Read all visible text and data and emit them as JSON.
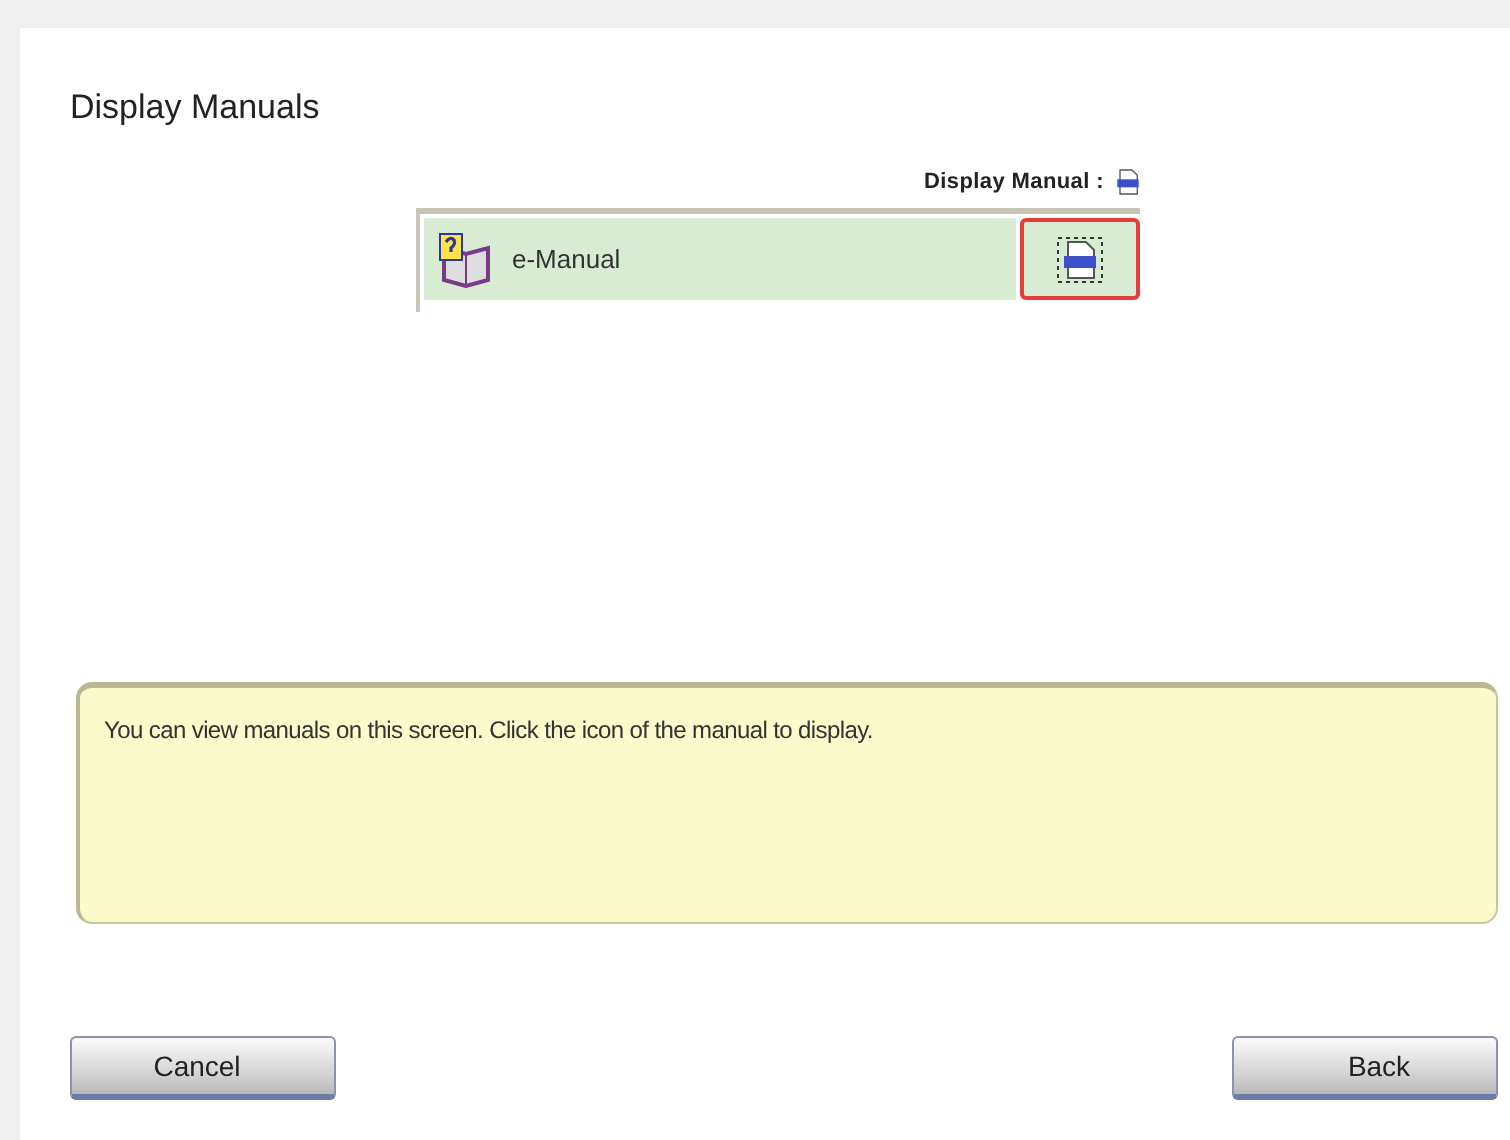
{
  "title": "Display Manuals",
  "legend": {
    "label": "Display Manual :"
  },
  "manuals": [
    {
      "name": "e-Manual",
      "highlighted": true
    }
  ],
  "message": "You can view manuals on this screen. Click the icon of the manual to display.",
  "buttons": [
    {
      "label": "Cancel",
      "kind": "cancel"
    },
    {
      "label": "Back",
      "kind": "back"
    }
  ]
}
